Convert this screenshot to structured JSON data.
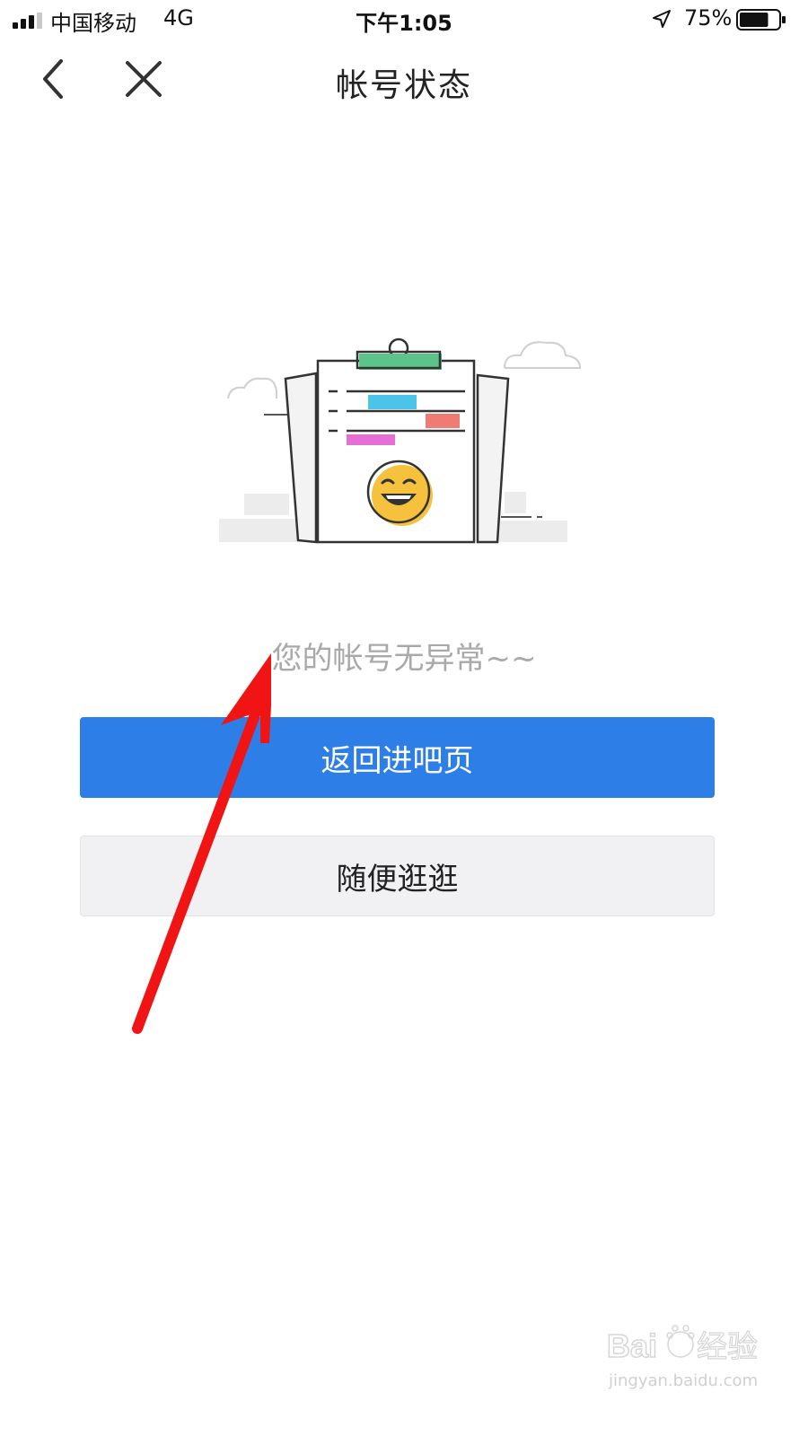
{
  "status_bar": {
    "carrier": "中国移动",
    "network": "4G",
    "time": "下午1:05",
    "battery_percent": "75%",
    "battery_level": 0.75
  },
  "nav": {
    "title": "帐号状态"
  },
  "main": {
    "message": "您的帐号无异常~~",
    "primary_button": "返回进吧页",
    "secondary_button": "随便逛逛"
  },
  "watermark": {
    "logo_text": "Baidu经验",
    "url": "jingyan.baidu.com"
  },
  "colors": {
    "primary": "#2e7ee8",
    "annotation_arrow": "#f01414"
  }
}
